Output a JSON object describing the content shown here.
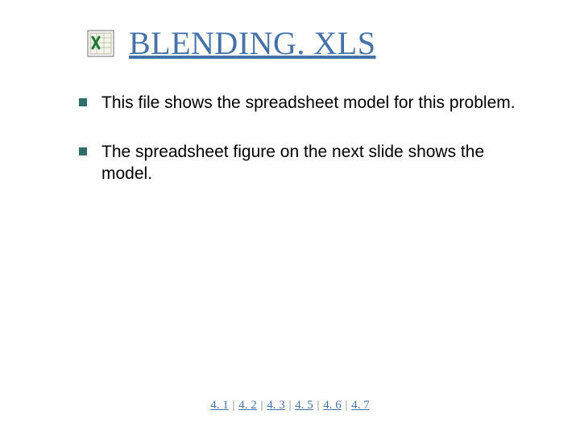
{
  "title": "BLENDING. XLS",
  "icon_name": "excel-file-icon",
  "bullets": [
    "This file shows the spreadsheet model for this problem.",
    "The spreadsheet figure on the next slide shows the model."
  ],
  "footer_links": [
    "4. 1",
    "4. 2",
    "4. 3",
    "4. 5",
    "4. 6",
    "4. 7"
  ],
  "footer_separator": " | ",
  "colors": {
    "title_link": "#4472a8",
    "bullet_square": "#2f6d6a",
    "footer_link": "#4472a8"
  }
}
